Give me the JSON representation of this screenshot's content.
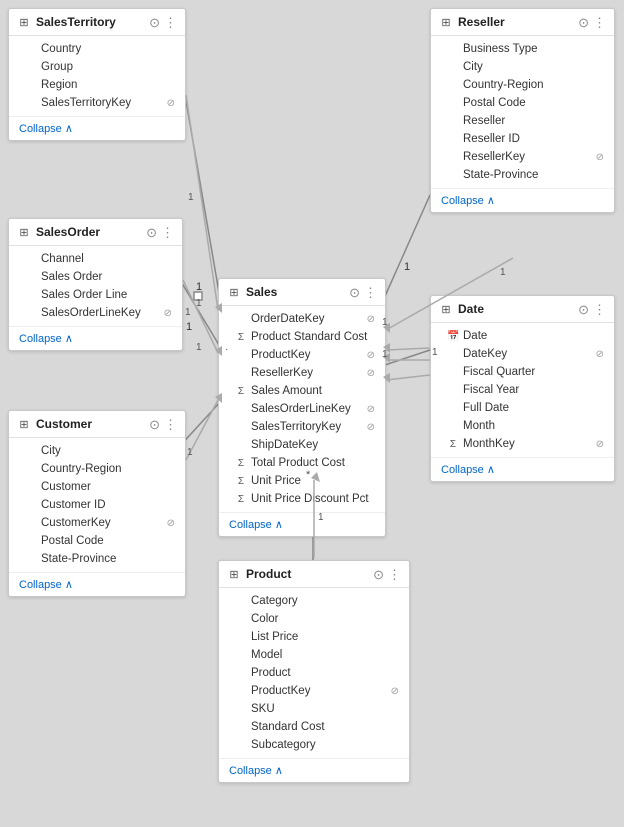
{
  "tables": {
    "salesTerritory": {
      "title": "SalesTerritory",
      "fields": [
        {
          "name": "Country",
          "prefix": "",
          "key": false
        },
        {
          "name": "Group",
          "prefix": "",
          "key": false
        },
        {
          "name": "Region",
          "prefix": "",
          "key": false
        },
        {
          "name": "SalesTerritoryKey",
          "prefix": "",
          "key": true
        }
      ],
      "collapse": "Collapse"
    },
    "salesOrder": {
      "title": "SalesOrder",
      "fields": [
        {
          "name": "Channel",
          "prefix": "",
          "key": false
        },
        {
          "name": "Sales Order",
          "prefix": "",
          "key": false
        },
        {
          "name": "Sales Order Line",
          "prefix": "",
          "key": false
        },
        {
          "name": "SalesOrderLineKey",
          "prefix": "",
          "key": true
        }
      ],
      "collapse": "Collapse"
    },
    "customer": {
      "title": "Customer",
      "fields": [
        {
          "name": "City",
          "prefix": "",
          "key": false
        },
        {
          "name": "Country-Region",
          "prefix": "",
          "key": false
        },
        {
          "name": "Customer",
          "prefix": "",
          "key": false
        },
        {
          "name": "Customer ID",
          "prefix": "",
          "key": false
        },
        {
          "name": "CustomerKey",
          "prefix": "",
          "key": true
        },
        {
          "name": "Postal Code",
          "prefix": "",
          "key": false
        },
        {
          "name": "State-Province",
          "prefix": "",
          "key": false
        }
      ],
      "collapse": "Collapse"
    },
    "sales": {
      "title": "Sales",
      "fields": [
        {
          "name": "OrderDateKey",
          "prefix": "",
          "key": true
        },
        {
          "name": "Product Standard Cost",
          "prefix": "Σ",
          "key": false
        },
        {
          "name": "ProductKey",
          "prefix": "",
          "key": true
        },
        {
          "name": "ResellerKey",
          "prefix": "",
          "key": true
        },
        {
          "name": "Sales Amount",
          "prefix": "Σ",
          "key": false
        },
        {
          "name": "SalesOrderLineKey",
          "prefix": "",
          "key": true
        },
        {
          "name": "SalesTerritoryKey",
          "prefix": "",
          "key": true
        },
        {
          "name": "ShipDateKey",
          "prefix": "",
          "key": false
        },
        {
          "name": "Total Product Cost",
          "prefix": "Σ",
          "key": false
        },
        {
          "name": "Unit Price",
          "prefix": "Σ",
          "key": false
        },
        {
          "name": "Unit Price Discount Pct",
          "prefix": "Σ",
          "key": false
        }
      ],
      "collapse": "Collapse"
    },
    "reseller": {
      "title": "Reseller",
      "fields": [
        {
          "name": "Business Type",
          "prefix": "",
          "key": false
        },
        {
          "name": "City",
          "prefix": "",
          "key": false
        },
        {
          "name": "Country-Region",
          "prefix": "",
          "key": false
        },
        {
          "name": "Postal Code",
          "prefix": "",
          "key": false
        },
        {
          "name": "Reseller",
          "prefix": "",
          "key": false
        },
        {
          "name": "Reseller ID",
          "prefix": "",
          "key": false
        },
        {
          "name": "ResellerKey",
          "prefix": "",
          "key": true
        },
        {
          "name": "State-Province",
          "prefix": "",
          "key": false
        }
      ],
      "collapse": "Collapse"
    },
    "date": {
      "title": "Date",
      "fields": [
        {
          "name": "Date",
          "prefix": "📅",
          "key": false
        },
        {
          "name": "DateKey",
          "prefix": "",
          "key": true
        },
        {
          "name": "Fiscal Quarter",
          "prefix": "",
          "key": false
        },
        {
          "name": "Fiscal Year",
          "prefix": "",
          "key": false
        },
        {
          "name": "Full Date",
          "prefix": "",
          "key": false
        },
        {
          "name": "Month",
          "prefix": "",
          "key": false
        },
        {
          "name": "MonthKey",
          "prefix": "Σ",
          "key": true
        }
      ],
      "collapse": "Collapse"
    },
    "product": {
      "title": "Product",
      "fields": [
        {
          "name": "Category",
          "prefix": "",
          "key": false
        },
        {
          "name": "Color",
          "prefix": "",
          "key": false
        },
        {
          "name": "List Price",
          "prefix": "",
          "key": false
        },
        {
          "name": "Model",
          "prefix": "",
          "key": false
        },
        {
          "name": "Product",
          "prefix": "",
          "key": false
        },
        {
          "name": "ProductKey",
          "prefix": "",
          "key": true
        },
        {
          "name": "SKU",
          "prefix": "",
          "key": false
        },
        {
          "name": "Standard Cost",
          "prefix": "",
          "key": false
        },
        {
          "name": "Subcategory",
          "prefix": "",
          "key": false
        }
      ],
      "collapse": "Collapse"
    }
  },
  "icons": {
    "table": "⊞",
    "eye": "👁",
    "more": "⋮",
    "key": "🔑",
    "chevron_up": "∧",
    "lock": "🔒",
    "hide": "⊘"
  }
}
